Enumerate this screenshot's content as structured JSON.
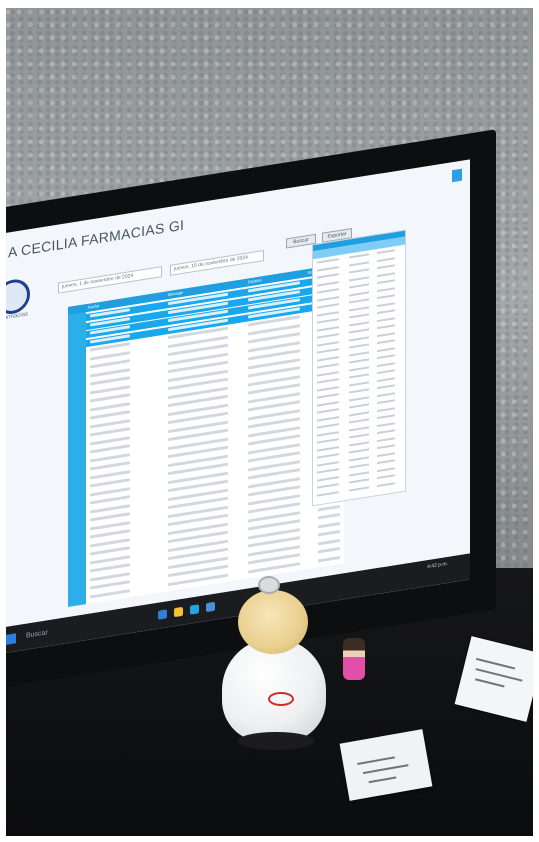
{
  "app": {
    "title": "A CECILIA FARMACIAS GI",
    "logo_label": "Farmacias"
  },
  "filters": {
    "date_from": "jueves, 1 de noviembre de 2024",
    "date_to": "jueves, 15 de noviembre de 2024",
    "buttons": [
      "Buscar",
      "Exportar"
    ]
  },
  "table": {
    "headers": [
      "Fecha",
      "Mensaje",
      "Destino",
      "Estado"
    ],
    "selected_rows": 4,
    "total_rows": 34
  },
  "taskbar": {
    "search_label": "Buscar",
    "clock": "4:42 p.m."
  },
  "colors": {
    "accent": "#1f9fe0",
    "selection": "#17a8ee",
    "bezel": "#0d0e10",
    "wall": "#9a9fa2"
  },
  "icons": [
    "windows-start-icon",
    "search-icon",
    "close-icon",
    "logo-icon"
  ]
}
